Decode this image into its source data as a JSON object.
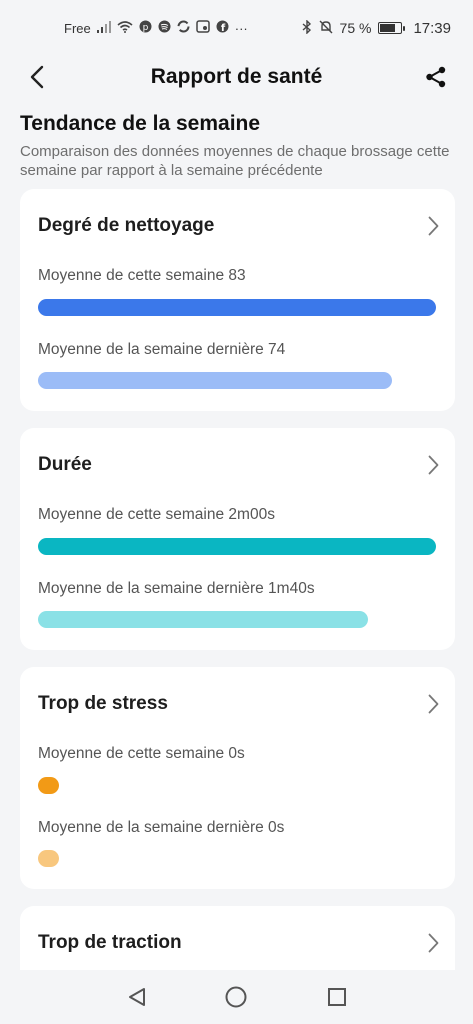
{
  "status_bar": {
    "carrier": "Free",
    "more": "···",
    "battery": "75 %",
    "battery_level": 0.75,
    "time": "17:39"
  },
  "header": {
    "title": "Rapport de santé"
  },
  "section": {
    "title": "Tendance de la semaine",
    "subtitle": "Comparaison des données moyennes de chaque brossage cette semaine par rapport à la semaine précédente"
  },
  "cards": [
    {
      "title": "Degré de nettoyage",
      "this_week_label": "Moyenne de cette semaine 83",
      "last_week_label": "Moyenne de la semaine dernière 74",
      "this_week_fraction": 1.0,
      "last_week_fraction": 0.89,
      "color_this": "#3b78ea",
      "color_last": "#9bbcf7"
    },
    {
      "title": "Durée",
      "this_week_label": "Moyenne de cette semaine 2m00s",
      "last_week_label": "Moyenne de la semaine dernière 1m40s",
      "this_week_fraction": 1.0,
      "last_week_fraction": 0.83,
      "color_this": "#0ab6c2",
      "color_last": "#8ae1e6"
    },
    {
      "title": "Trop de stress",
      "this_week_label": "Moyenne de cette semaine 0s",
      "last_week_label": "Moyenne de la semaine dernière 0s",
      "this_week_fraction": 0,
      "last_week_fraction": 0,
      "color_this": "#f29a16",
      "color_last": "#f8c77e"
    },
    {
      "title": "Trop de traction"
    }
  ]
}
